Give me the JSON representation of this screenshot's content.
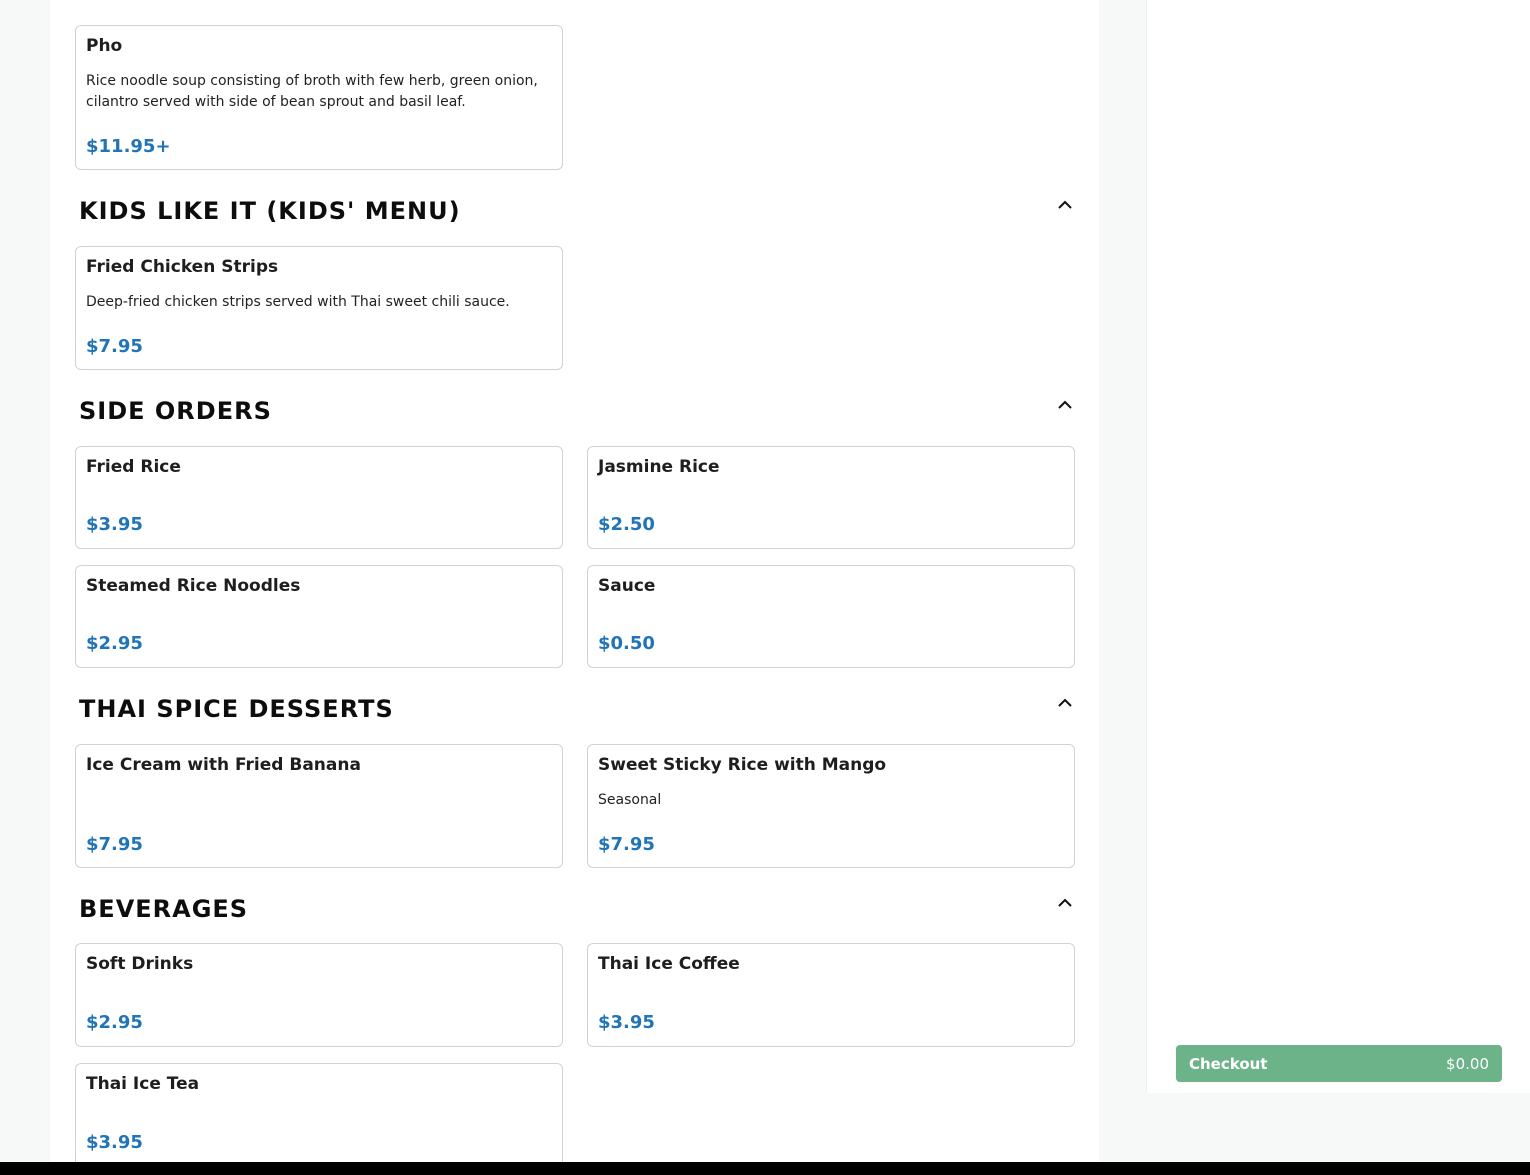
{
  "sections": {
    "kids": {
      "title": "KIDS LIKE IT (KIDS' MENU)"
    },
    "sides": {
      "title": "SIDE ORDERS"
    },
    "desserts": {
      "title": "THAI SPICE DESSERTS"
    },
    "beverages": {
      "title": "BEVERAGES"
    }
  },
  "items": {
    "pho": {
      "name": "Pho",
      "desc": "Rice noodle soup consisting of broth with few herb, green onion, cilantro served with side of bean sprout and basil leaf.",
      "price": "$11.95+"
    },
    "fried_chicken_strips": {
      "name": "Fried Chicken Strips",
      "desc": "Deep-fried chicken strips served with Thai sweet chili sauce.",
      "price": "$7.95"
    },
    "fried_rice": {
      "name": "Fried Rice",
      "price": "$3.95"
    },
    "jasmine_rice": {
      "name": "Jasmine Rice",
      "price": "$2.50"
    },
    "steamed_rice_noodles": {
      "name": "Steamed Rice Noodles",
      "price": "$2.95"
    },
    "sauce": {
      "name": "Sauce",
      "price": "$0.50"
    },
    "ice_cream": {
      "name": "Ice Cream with Fried Banana",
      "price": "$7.95"
    },
    "sticky_rice": {
      "name": "Sweet Sticky Rice with Mango",
      "desc": "Seasonal",
      "price": "$7.95"
    },
    "soft_drinks": {
      "name": "Soft Drinks",
      "price": "$2.95"
    },
    "thai_ice_coffee": {
      "name": "Thai Ice Coffee",
      "price": "$3.95"
    },
    "thai_ice_tea": {
      "name": "Thai Ice Tea",
      "price": "$3.95"
    }
  },
  "cart": {
    "checkout_label": "Checkout",
    "total": "$0.00"
  },
  "colors": {
    "price": "#2174b8",
    "checkout": "#6db38a"
  },
  "icons": {
    "collapse": "chevron-up-icon"
  }
}
